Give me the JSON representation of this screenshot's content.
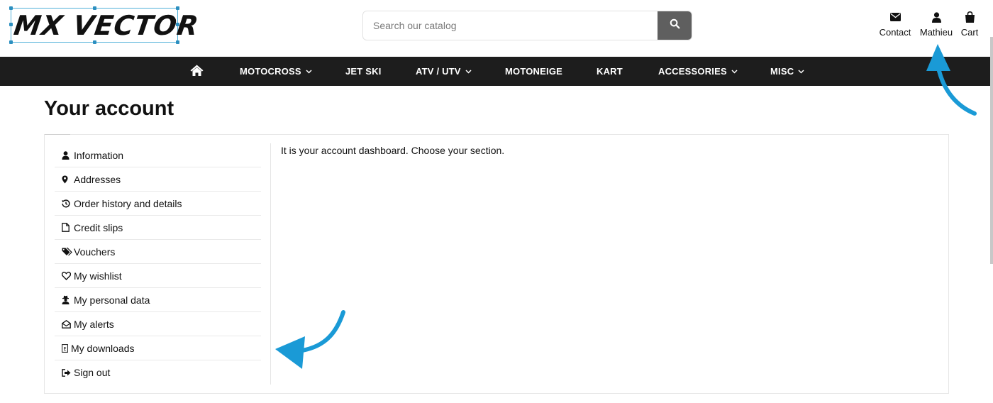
{
  "brand": {
    "logo_text": "MX VECTOR"
  },
  "search": {
    "placeholder": "Search our catalog"
  },
  "top_links": {
    "contact": "Contact",
    "account": "Mathieu",
    "cart": "Cart"
  },
  "nav": {
    "items": [
      {
        "label": "MOTOCROSS",
        "has_dropdown": true
      },
      {
        "label": "JET SKI",
        "has_dropdown": false
      },
      {
        "label": "ATV / UTV",
        "has_dropdown": true
      },
      {
        "label": "MOTONEIGE",
        "has_dropdown": false
      },
      {
        "label": "KART",
        "has_dropdown": false
      },
      {
        "label": "ACCESSORIES",
        "has_dropdown": true
      },
      {
        "label": "MISC",
        "has_dropdown": true
      }
    ]
  },
  "page": {
    "title": "Your account",
    "dashboard_text": "It is your account dashboard. Choose your section."
  },
  "account_menu": {
    "items": [
      {
        "label": "Information",
        "icon": "user-icon"
      },
      {
        "label": "Addresses",
        "icon": "map-pin-icon"
      },
      {
        "label": "Order history and details",
        "icon": "history-icon"
      },
      {
        "label": "Credit slips",
        "icon": "file-icon"
      },
      {
        "label": "Vouchers",
        "icon": "tags-icon"
      },
      {
        "label": "My wishlist",
        "icon": "heart-icon"
      },
      {
        "label": "My personal data",
        "icon": "user-secret-icon"
      },
      {
        "label": "My alerts",
        "icon": "envelope-open-icon"
      },
      {
        "label": "My downloads",
        "icon": "missing-glyph-icon"
      },
      {
        "label": "Sign out",
        "icon": "sign-out-icon"
      }
    ]
  },
  "colors": {
    "nav_background": "#1d1d1d",
    "search_button": "#5f5f5f",
    "annotation_arrow": "#1a9ad6",
    "logo_selection": "#4fb0d8"
  }
}
